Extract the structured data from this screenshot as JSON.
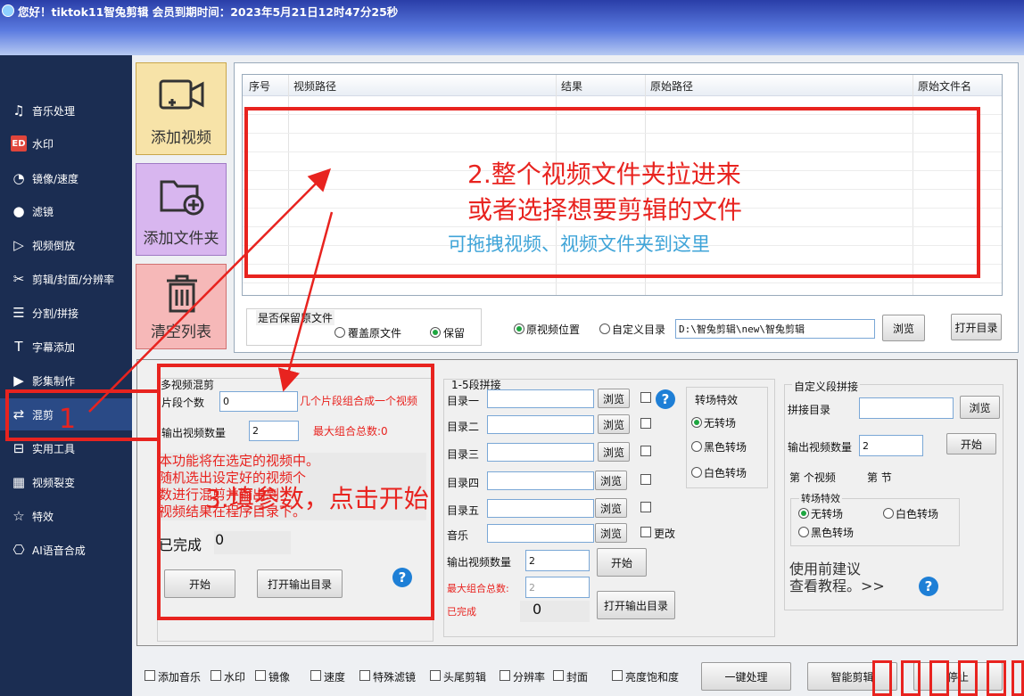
{
  "window": {
    "title": "您好！tiktok11智兔剪辑  会员到期时间：2023年5月21日12时47分25秒"
  },
  "sidebar": {
    "items": [
      {
        "label": "音乐处理",
        "icon": "music-icon"
      },
      {
        "label": "水印",
        "icon": "watermark-icon"
      },
      {
        "label": "镜像/速度",
        "icon": "speed-icon"
      },
      {
        "label": "滤镜",
        "icon": "filter-icon"
      },
      {
        "label": "视频倒放",
        "icon": "reverse-icon"
      },
      {
        "label": "剪辑/封面/分辨率",
        "icon": "scissors-icon"
      },
      {
        "label": "分割/拼接",
        "icon": "split-icon"
      },
      {
        "label": "字幕添加",
        "icon": "subtitle-icon"
      },
      {
        "label": "影集制作",
        "icon": "album-icon"
      },
      {
        "label": "混剪",
        "icon": "shuffle-icon"
      },
      {
        "label": "实用工具",
        "icon": "toolbox-icon"
      },
      {
        "label": "视频裂变",
        "icon": "fission-icon"
      },
      {
        "label": "特效",
        "icon": "star-icon"
      },
      {
        "label": "AI语音合成",
        "icon": "ai-voice-icon"
      }
    ],
    "active_index": 9
  },
  "tiles": {
    "add_video": "添加视频",
    "add_folder": "添加文件夹",
    "clear_list": "清空列表"
  },
  "table": {
    "columns": [
      "序号",
      "视频路径",
      "结果",
      "原始路径",
      "原始文件名"
    ],
    "drop_hint": "可拖拽视频、视频文件夹到这里"
  },
  "options": {
    "keep_label": "是否保留原文件",
    "overwrite": "覆盖原文件",
    "keep": "保留",
    "original_location": "原视频位置",
    "custom_dir": "自定义目录",
    "output_path": "D:\\智兔剪辑\\new\\智兔剪辑",
    "browse": "浏览",
    "open_dir": "打开目录"
  },
  "multi_mix": {
    "title": "多视频混剪",
    "segments_label": "片段个数",
    "segments_value": "0",
    "segments_hint": "几个片段组合成一个视频",
    "output_count_label": "输出视频数量",
    "output_count_value": "2",
    "max_combo": "最大组合总数:0",
    "desc": [
      "本功能将在选定的视频中。",
      "随机选出设定好的视频个",
      "数进行混剪并输出到",
      "视频结果在程序目录下。"
    ],
    "done_label": "已完成",
    "done_value": "0",
    "start": "开始",
    "open_output": "打开输出目录"
  },
  "segment_join": {
    "title": "1-5段拼接",
    "rows": [
      "目录一",
      "目录二",
      "目录三",
      "目录四",
      "目录五",
      "音乐"
    ],
    "browse": "浏览",
    "change": "更改",
    "transition_title": "转场特效",
    "transitions": [
      "无转场",
      "黑色转场",
      "白色转场"
    ],
    "output_count_label": "输出视频数量",
    "output_count_value": "2",
    "start": "开始",
    "max_combo_label": "最大组合总数:",
    "max_combo_value": "2",
    "done_label": "已完成",
    "done_value": "0",
    "open_output": "打开输出目录"
  },
  "custom_join": {
    "title": "自定义段拼接",
    "dir_label": "拼接目录",
    "browse": "浏览",
    "output_count_label": "输出视频数量",
    "output_count_value": "2",
    "start": "开始",
    "nth_video": "第 个视频",
    "nth_section": "第 节",
    "transition_title": "转场特效",
    "transitions": [
      "无转场",
      "白色转场",
      "黑色转场"
    ],
    "tip": [
      "使用前建议",
      "查看教程。>>"
    ]
  },
  "bottom": {
    "checks": [
      "添加音乐",
      "水印",
      "镜像",
      "速度",
      "特殊滤镜",
      "头尾剪辑",
      "分辨率",
      "封面",
      "亮度饱和度"
    ],
    "one_click": "一键处理",
    "smart_edit": "智能剪辑",
    "stop": "停止"
  },
  "annotations": {
    "step1": "1",
    "step2_line1": "2.整个视频文件夹拉进来",
    "step2_line2": "或者选择想要剪辑的文件",
    "step3": "3.填参数，点击开始"
  },
  "colors": {
    "annotation_red": "#e8231f",
    "sidebar_bg": "#1b2d52",
    "hint_blue": "#3fa4d8"
  }
}
